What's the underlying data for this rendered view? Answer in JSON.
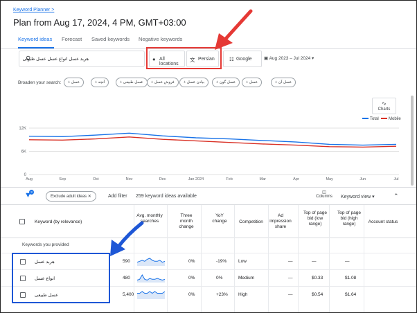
{
  "breadcrumb": "Keyword Planner >",
  "page_title": "Plan from Aug 17, 2024, 4 PM, GMT+03:00",
  "tabs": [
    "Keyword ideas",
    "Forecast",
    "Saved keywords",
    "Negative keywords"
  ],
  "search": {
    "query": "هربد عسل انواع عسل عسل طبیعی"
  },
  "locations_label": "All locations",
  "language_label": "Persian",
  "network_label": "Google",
  "date_range": "Aug 2023 – Jul 2024",
  "broaden_label": "Broaden your search:",
  "broaden_chips": [
    "+ عسل",
    "+ آنچه",
    "+ عسل طبیعی",
    "+ فروش عسل",
    "+ بیادن عسل",
    "+ عسل گون",
    "+ عسل",
    "+ عسل آن"
  ],
  "charts_button": "Charts",
  "legend": [
    {
      "name": "Total",
      "color": "#1a73e8"
    },
    {
      "name": "Mobile",
      "color": "#d93025"
    }
  ],
  "chart_data": {
    "type": "line",
    "x": [
      "Aug",
      "Sep",
      "Oct",
      "Nov",
      "Dec",
      "Jan 2024",
      "Feb",
      "Mar",
      "Apr",
      "May",
      "Jun",
      "Jul"
    ],
    "ylim": [
      0,
      12000
    ],
    "yticks": [
      "0",
      "6K",
      "12K"
    ],
    "series": [
      {
        "name": "Total",
        "values": [
          9900,
          9800,
          10200,
          10700,
          10000,
          9500,
          9200,
          8800,
          8400,
          7800,
          7600,
          7800
        ]
      },
      {
        "name": "Mobile",
        "values": [
          9000,
          8900,
          9200,
          9700,
          9100,
          8700,
          8300,
          7900,
          7600,
          7200,
          7100,
          7300
        ]
      }
    ]
  },
  "filter_bar": {
    "badge": "3",
    "exclude_label": "Exclude adult ideas",
    "add_filter": "Add filter",
    "count_text": "259 keyword ideas available",
    "columns_label": "Columns",
    "keyword_view": "Keyword view"
  },
  "headers": {
    "keyword": "Keyword (by relevance)",
    "avg": "Avg. monthly searches",
    "three_month": "Three month change",
    "yoy": "YoY change",
    "competition": "Competition",
    "ad_impr": "Ad impression share",
    "bid_low": "Top of page bid (low range)",
    "bid_high": "Top of page bid (high range)",
    "account_status": "Account status"
  },
  "section_label": "Keywords you provided",
  "rows": [
    {
      "keyword": "هربد عسل",
      "avg": "590",
      "three_month": "0%",
      "yoy": "-19%",
      "competition": "Low",
      "ad_impr": "—",
      "bid_low": "—",
      "bid_high": "—",
      "trend": [
        3,
        4,
        5,
        4,
        6,
        7,
        5,
        4,
        4,
        5,
        3,
        4
      ]
    },
    {
      "keyword": "انواع عسل",
      "avg": "480",
      "three_month": "0%",
      "yoy": "0%",
      "competition": "Medium",
      "ad_impr": "—",
      "bid_low": "$0.33",
      "bid_high": "$1.08",
      "trend": [
        2,
        3,
        8,
        3,
        2,
        4,
        3,
        3,
        4,
        3,
        2,
        3
      ]
    },
    {
      "keyword": "عسل طبیعی",
      "avg": "5,400",
      "three_month": "0%",
      "yoy": "+23%",
      "competition": "High",
      "ad_impr": "—",
      "bid_low": "$0.54",
      "bid_high": "$1.64",
      "trend": [
        3,
        3,
        4,
        3,
        3,
        4,
        3,
        4,
        3,
        3,
        3,
        4
      ]
    }
  ]
}
